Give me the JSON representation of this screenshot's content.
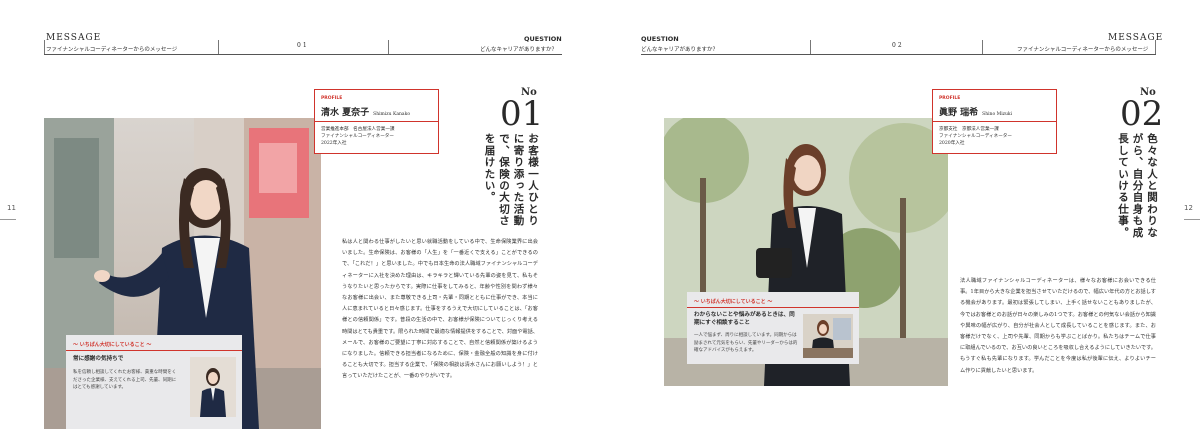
{
  "header": {
    "left": {
      "message_title": "MESSAGE",
      "message_sub": "ファイナンシャルコーディネーターからのメッセージ",
      "number": "01",
      "question_title": "QUESTION",
      "question_sub": "どんなキャリアがありますか？"
    },
    "right": {
      "question_title": "QUESTION",
      "question_sub": "どんなキャリアがありますか？",
      "number": "02",
      "message_title": "MESSAGE",
      "message_sub": "ファイナンシャルコーディネーターからのメッセージ"
    }
  },
  "page_numbers": {
    "left": "11",
    "right": "12"
  },
  "left_article": {
    "profile": {
      "tag": "PROFILE",
      "name": "清水 夏奈子",
      "roman": "Shimizu Kanako",
      "dept": "営業推進本部　名古屋法人営業一課",
      "role": "ファイナンシャルコーディネーター",
      "joined": "2022年入社"
    },
    "no_label": "No",
    "no_number": "01",
    "headline": "お客様一人ひとりに寄り添った活動で、保険の大切さを届けたい。",
    "body": "私は人と関わる仕事がしたいと思い就職活動をしている中で、生命保険業界に出会いました。生命保険は、お客様の「人生」を「一番近くで支える」ことができるので、「これだ！」と思いました。中でも日本生命の法人職域ファイナンシャルコーディネーターに入社を決めた理由は、キラキラと輝いている先輩の姿を見て、私もそうなりたいと思ったからです。実際に仕事をしてみると、年齢や性別を問わず様々なお客様に出会い、また尊敬できる上司・先輩・同期とともに仕事ができ、本当に人に恵まれていると日々感じます。仕事をするうえで大切にしていることは、「お客様との信頼関係」です。普段の生活の中で、お客様が保険についてじっくり考える時間はとても貴重です。限られた時間で最適な情報提供をすることで、対面や電話、メールで、お客様のご要望に丁寧に対応することで、自然と信頼関係が築けるようになりました。信頼できる担当者になるために、保険・金融全般の知識を身に付けることも大切です。担当する企業で、「保険の相談は清水さんにお願いしよう！」と言っていただけたことが、一番のやりがいです。",
    "card": {
      "tag": "〜 いちばん大切にしていること 〜",
      "title": "常に感謝の気持ちで",
      "text": "私を信頼し相談してくれたお客様、貴重な時間をくださった企業様、支えてくれる上司、先輩、同期にはとても感謝しています。"
    }
  },
  "right_article": {
    "profile": {
      "tag": "PROFILE",
      "name": "眞野 瑞希",
      "roman": "Shino Mizuki",
      "dept": "京都支社　京都法人営業一課",
      "role": "ファイナンシャルコーディネーター",
      "joined": "2020年入社"
    },
    "no_label": "No",
    "no_number": "02",
    "headline": "色々な人と関わりながら、自分自身も成長していける仕事。",
    "body": "法人職域ファイナンシャルコーディネーターは、様々なお客様にお会いできる仕事。1年目から大きな企業を担当させていただけるので、幅広い年代の方とお話しする機会があります。最初は緊張してしまい、上手く話せないこともありましたが、今ではお客様とのお話が日々の楽しみの1つです。お客様との何気ない会話から知識や興味の幅が広がり、自分が社会人として成長していることを感じます。また、お客様だけでなく、上司や先輩、同期からも学ぶことばかり。私たちはチームで仕事に取組んでいるので、お互いの良いところを吸収し合えるようにしていきたいです。もうすぐ私も先輩になります。学んだことを今度は私が後輩に伝え、よりよいチーム作りに貢献したいと思います。",
    "card": {
      "tag": "〜 いちばん大切にしていること 〜",
      "title": "わからないことや悩みがあるときは、同期にすぐ相談すること",
      "text": "一人で悩まず、周りに相談しています。同期からは励まされて元気をもらい、先輩やリーダーからは的確なアドバイスがもらえます。"
    }
  },
  "colors": {
    "accent": "#d0342c",
    "card_bg": "#e9e9eb",
    "rule": "#555555"
  }
}
